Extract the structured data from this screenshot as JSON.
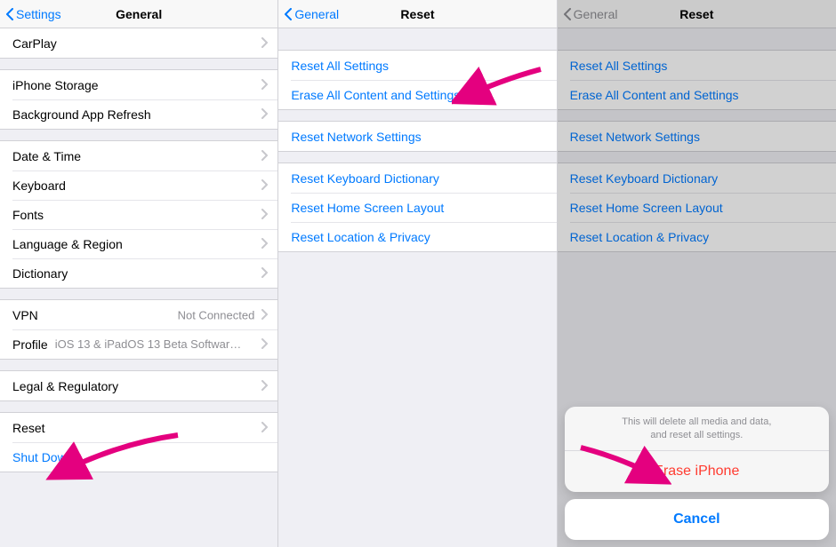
{
  "panel1": {
    "back": "Settings",
    "title": "General",
    "g1": [
      "CarPlay"
    ],
    "g2": [
      "iPhone Storage",
      "Background App Refresh"
    ],
    "g3": [
      "Date & Time",
      "Keyboard",
      "Fonts",
      "Language & Region",
      "Dictionary"
    ],
    "g4": {
      "vpn_label": "VPN",
      "vpn_value": "Not Connected",
      "profile_label": "Profile",
      "profile_value": "iOS 13 & iPadOS 13 Beta Software Pr..."
    },
    "g5": [
      "Legal & Regulatory"
    ],
    "g6": {
      "reset": "Reset",
      "shutdown": "Shut Down"
    }
  },
  "panel2": {
    "back": "General",
    "title": "Reset",
    "g1": [
      "Reset All Settings",
      "Erase All Content and Settings"
    ],
    "g2": [
      "Reset Network Settings"
    ],
    "g3": [
      "Reset Keyboard Dictionary",
      "Reset Home Screen Layout",
      "Reset Location & Privacy"
    ]
  },
  "panel3": {
    "back": "General",
    "title": "Reset",
    "g1": [
      "Reset All Settings",
      "Erase All Content and Settings"
    ],
    "g2": [
      "Reset Network Settings"
    ],
    "g3": [
      "Reset Keyboard Dictionary",
      "Reset Home Screen Layout",
      "Reset Location & Privacy"
    ],
    "sheet": {
      "message_l1": "This will delete all media and data,",
      "message_l2": "and reset all settings.",
      "erase": "Erase iPhone",
      "cancel": "Cancel"
    }
  }
}
